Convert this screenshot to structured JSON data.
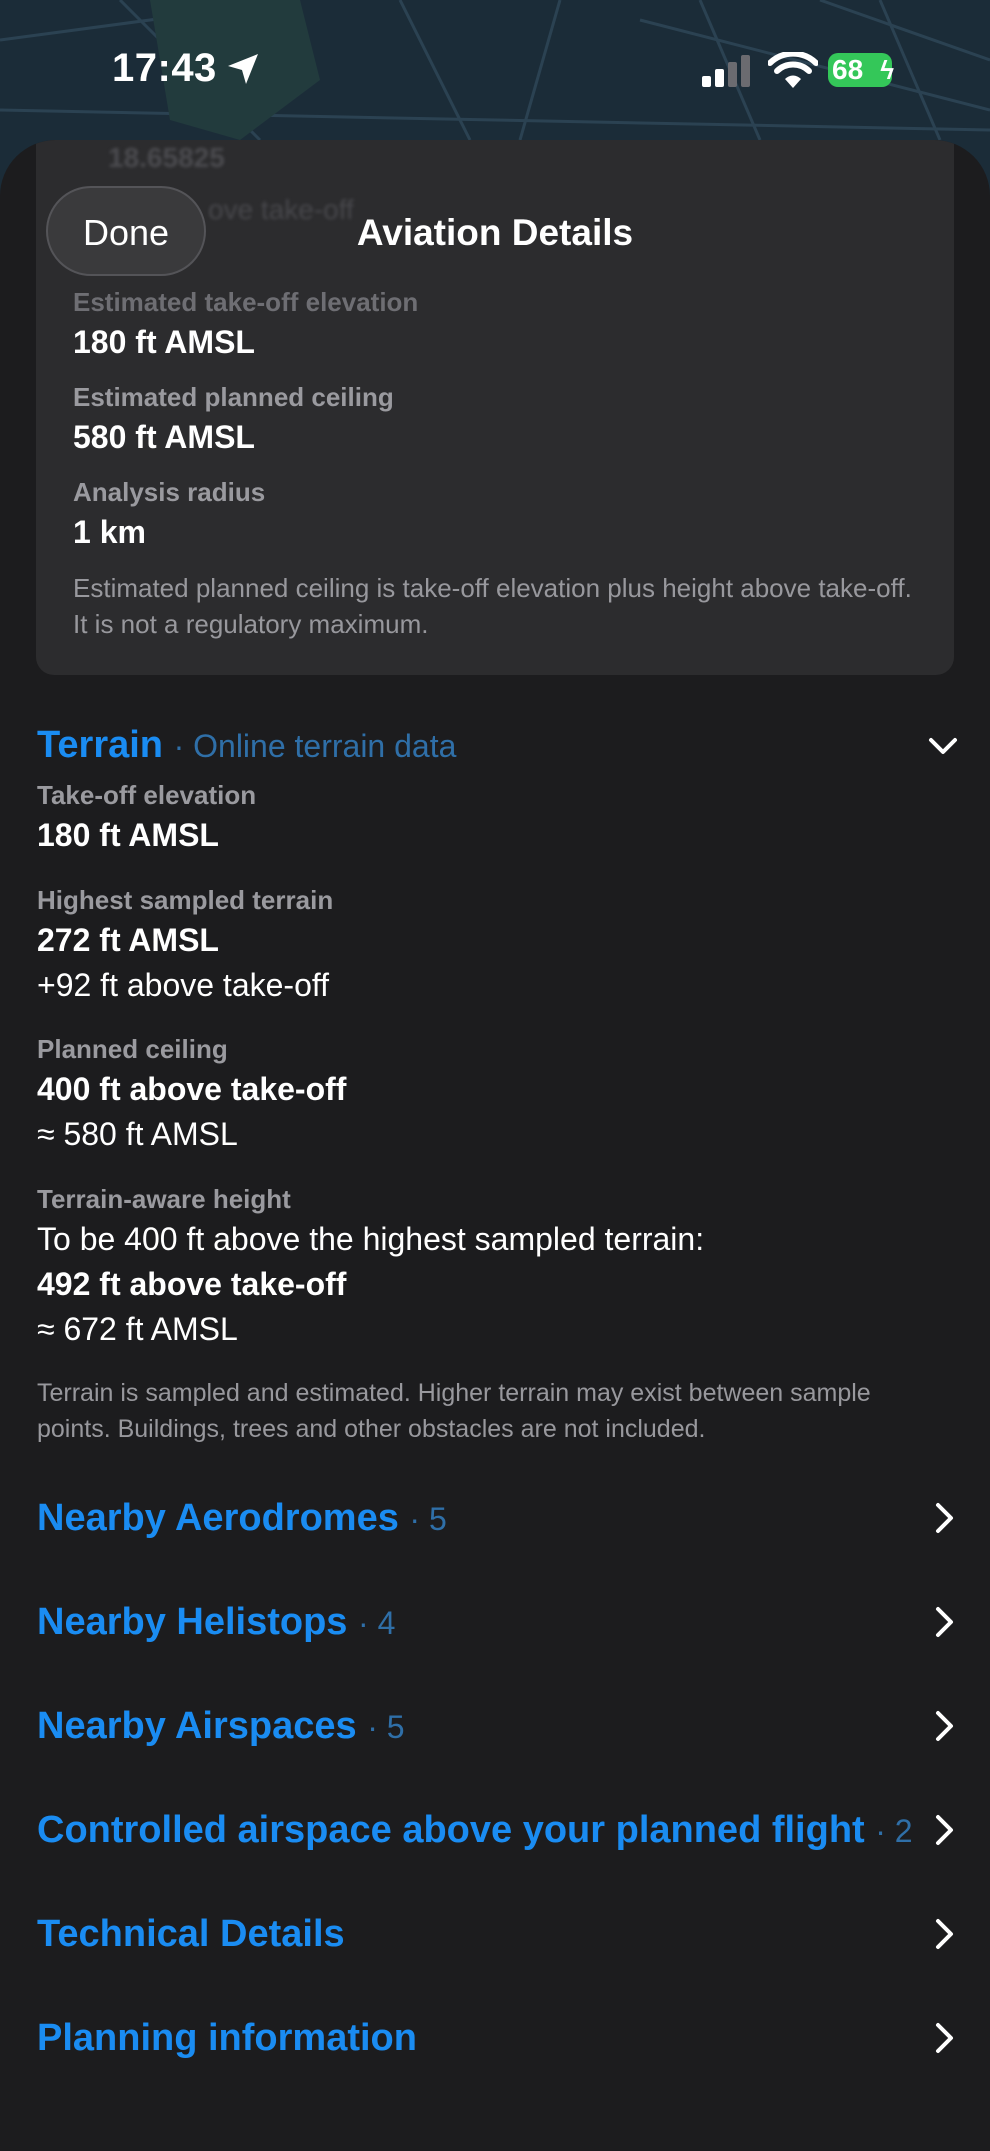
{
  "status_bar": {
    "time": "17:43",
    "battery": "68",
    "icons": [
      "location-arrow-icon",
      "cellular-signal-icon",
      "wifi-icon",
      "battery-charging-icon"
    ]
  },
  "header": {
    "done_label": "Done",
    "title": "Aviation Details"
  },
  "summary": {
    "ghost_value": "18.65825",
    "ghost_label": "ove take-off",
    "takeoff_label": "Estimated take-off elevation",
    "takeoff_value": "180 ft AMSL",
    "ceiling_label": "Estimated planned ceiling",
    "ceiling_value": "580 ft AMSL",
    "radius_label": "Analysis radius",
    "radius_value": "1 km",
    "note": "Estimated planned ceiling is take-off elevation plus height above take-off. It is not a regulatory maximum."
  },
  "terrain": {
    "title": "Terrain",
    "source": "· Online terrain data",
    "takeoff_label": "Take-off elevation",
    "takeoff_value": "180 ft AMSL",
    "highest_label": "Highest sampled terrain",
    "highest_value": "272 ft AMSL",
    "highest_delta": "+92 ft above take-off",
    "ceiling_label": "Planned ceiling",
    "ceiling_value": "400 ft above take-off",
    "ceiling_amsl": "≈ 580 ft AMSL",
    "aware_label": "Terrain-aware height",
    "aware_text": "To be 400 ft above the highest sampled terrain:",
    "aware_value": "492 ft above take-off",
    "aware_amsl": "≈ 672 ft AMSL",
    "note": "Terrain is sampled and estimated. Higher terrain may exist between sample points. Buildings, trees and other obstacles are not included."
  },
  "sections": [
    {
      "title": "Nearby Aerodromes",
      "count": "· 5"
    },
    {
      "title": "Nearby Helistops",
      "count": "· 4"
    },
    {
      "title": "Nearby Airspaces",
      "count": "· 5"
    },
    {
      "title": "Controlled airspace above your planned flight",
      "count": "· 2"
    },
    {
      "title": "Technical Details",
      "count": ""
    },
    {
      "title": "Planning information",
      "count": ""
    }
  ],
  "colors": {
    "accent": "#1a8cf2",
    "sheet": "#1c1c1e",
    "card": "#2c2c2e",
    "battery": "#34c759"
  }
}
